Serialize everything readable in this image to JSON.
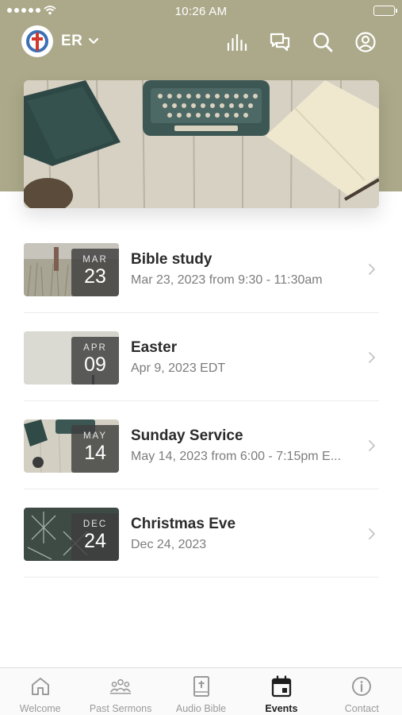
{
  "status_bar": {
    "time": "10:26 AM"
  },
  "header": {
    "church_name": "ER",
    "icons": [
      "live-bars-icon",
      "chat-icon",
      "search-icon",
      "profile-icon"
    ]
  },
  "colors": {
    "header_bg": "#aca98a",
    "active_nav": "#1d1d1d",
    "inactive_nav": "#9a9a9a"
  },
  "events": [
    {
      "month": "MAR",
      "day": "23",
      "title": "Bible study",
      "subtitle": "Mar 23, 2023 from 9:30 - 11:30am"
    },
    {
      "month": "APR",
      "day": "09",
      "title": "Easter",
      "subtitle": "Apr 9, 2023 EDT"
    },
    {
      "month": "MAY",
      "day": "14",
      "title": "Sunday Service",
      "subtitle": "May 14, 2023 from 6:00 - 7:15pm E..."
    },
    {
      "month": "DEC",
      "day": "24",
      "title": "Christmas Eve",
      "subtitle": "Dec 24, 2023"
    }
  ],
  "nav": {
    "items": [
      {
        "label": "Welcome",
        "icon": "home-icon"
      },
      {
        "label": "Past Sermons",
        "icon": "people-icon"
      },
      {
        "label": "Audio Bible",
        "icon": "bible-icon"
      },
      {
        "label": "Events",
        "icon": "calendar-icon",
        "active": true
      },
      {
        "label": "Contact",
        "icon": "info-icon"
      }
    ]
  }
}
